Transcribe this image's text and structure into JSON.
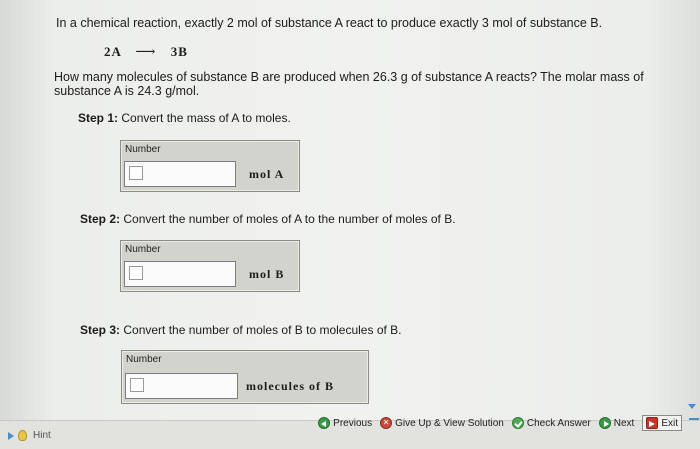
{
  "question": {
    "text": "In a chemical reaction, exactly 2 mol of substance A react to produce exactly 3 mol of substance B.",
    "equation_left": "2A",
    "equation_right": "3B",
    "prompt": "How many molecules of substance B are produced when 26.3 g of substance A reacts? The molar mass of substance A is 24.3 g/mol."
  },
  "steps": [
    {
      "label": "Step 1:",
      "text": "Convert the mass of A to moles.",
      "field_label": "Number",
      "value": "",
      "unit": "mol  A"
    },
    {
      "label": "Step 2:",
      "text": "Convert the number of moles of A to the number of moles of B.",
      "field_label": "Number",
      "value": "",
      "unit": "mol  B"
    },
    {
      "label": "Step 3:",
      "text": "Convert the number of moles of B to molecules of B.",
      "field_label": "Number",
      "value": "",
      "unit": "molecules  of  B"
    }
  ],
  "bottom": {
    "hint": "Hint",
    "previous": "Previous",
    "give_up": "Give Up & View Solution",
    "check": "Check Answer",
    "next": "Next",
    "exit": "Exit"
  }
}
